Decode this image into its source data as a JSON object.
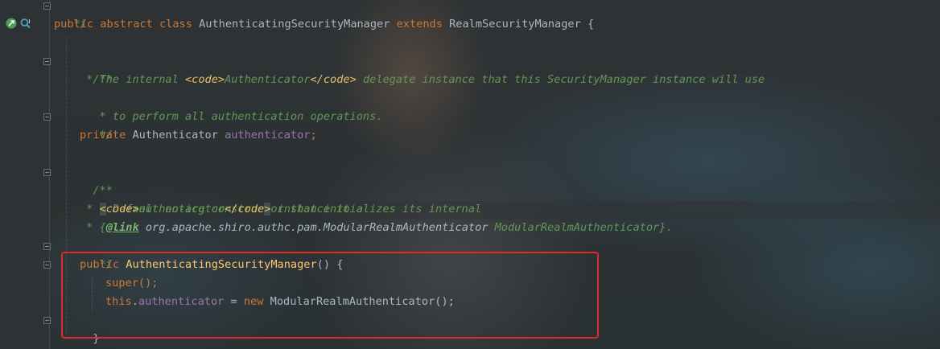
{
  "colors": {
    "keyword": "#cc7832",
    "comment": "#629755",
    "doc_tag": "#e8bf6a",
    "field": "#9876aa",
    "method": "#ffc66d",
    "text": "#a9b7c6",
    "highlight_box": "#e5282f"
  },
  "gutter": {
    "icons": [
      "override-implement-icon",
      "search-usages-icon"
    ]
  },
  "code": {
    "line0": {
      "comment": " */"
    },
    "line1": {
      "kw1": "public",
      "kw2": "abstract",
      "kw3": "class",
      "name": "AuthenticatingSecurityManager",
      "kw4": "extends",
      "parent": "RealmSecurityManager",
      "brace": " {"
    },
    "line3": {
      "comment": "/**"
    },
    "line4": {
      "c1": " * The internal ",
      "tag1": "<code>",
      "c2": "Authenticator",
      "tag2": "</code>",
      "c3": " delegate instance that this SecurityManager instance will use"
    },
    "line5": {
      "comment": " * to perform all authentication operations."
    },
    "line6": {
      "comment": " */"
    },
    "line7": {
      "kw": "private",
      "type": " Authenticator ",
      "field": "authenticator",
      "semi": ";"
    },
    "line9": {
      "comment": "/**"
    },
    "line10": {
      "comment": " * Default no-arg constructor that initializes its internal"
    },
    "line11": {
      "c1": " * ",
      "tag1": "<",
      "tag1b": "code>",
      "c2": "authenticator",
      "tag2": "</code",
      "tag2b": ">",
      "c3": " instance to a"
    },
    "line12": {
      "c1": " * {",
      "link": "@link",
      "c2": " ",
      "cls": "org.apache.shiro.authc.pam.ModularRealmAuthenticator",
      "c3": " ModularRealmAuthenticator}."
    },
    "line13": {
      "comment": " */"
    },
    "line14": {
      "kw": "public",
      "name": "AuthenticatingSecurityManager",
      "rest": "() {"
    },
    "line15": {
      "kw": "super",
      "rest": "();"
    },
    "line16": {
      "kw": "this",
      "dot": ".",
      "field": "authenticator",
      "eq": " = ",
      "kw2": "new",
      "rest": " ModularRealmAuthenticator();"
    },
    "line17": {
      "brace": "}"
    }
  }
}
